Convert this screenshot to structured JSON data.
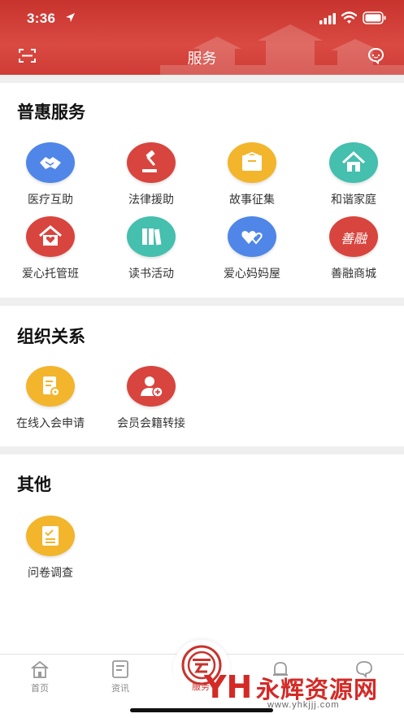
{
  "status_bar": {
    "time": "3:36"
  },
  "header": {
    "title": "服务"
  },
  "sections": [
    {
      "title": "普惠服务",
      "items": [
        {
          "label": "医疗互助",
          "icon": "handshake-icon",
          "color": "#4f86e8"
        },
        {
          "label": "法律援助",
          "icon": "gavel-icon",
          "color": "#d8453e"
        },
        {
          "label": "故事征集",
          "icon": "envelope-icon",
          "color": "#f2b52c"
        },
        {
          "label": "和谐家庭",
          "icon": "house-icon",
          "color": "#45bfae"
        },
        {
          "label": "爱心托管班",
          "icon": "heart-house-icon",
          "color": "#d8453e"
        },
        {
          "label": "读书活动",
          "icon": "books-icon",
          "color": "#45bfae"
        },
        {
          "label": "爱心妈妈屋",
          "icon": "hearts-icon",
          "color": "#4f86e8"
        },
        {
          "label": "善融商城",
          "icon": "shanrong-logo-icon",
          "color": "#d8453e",
          "logo_text": "善融"
        }
      ]
    },
    {
      "title": "组织关系",
      "items": [
        {
          "label": "在线入会申请",
          "icon": "application-form-icon",
          "color": "#f2b52c"
        },
        {
          "label": "会员会籍转接",
          "icon": "user-add-icon",
          "color": "#d8453e"
        }
      ]
    },
    {
      "title": "其他",
      "items": [
        {
          "label": "问卷调查",
          "icon": "questionnaire-icon",
          "color": "#f2b52c"
        }
      ]
    }
  ],
  "tabbar": {
    "items": [
      {
        "label": "首页",
        "icon": "home-icon"
      },
      {
        "label": "资讯",
        "icon": "news-icon"
      },
      {
        "label": "服务",
        "icon": "union-logo-icon",
        "active": true
      },
      {
        "label": "",
        "icon": "bell-icon"
      },
      {
        "label": "",
        "icon": "chat-icon"
      }
    ]
  },
  "watermark": {
    "mark": "YH",
    "text": "永辉资源网",
    "url": "www.yhkjjj.com"
  }
}
